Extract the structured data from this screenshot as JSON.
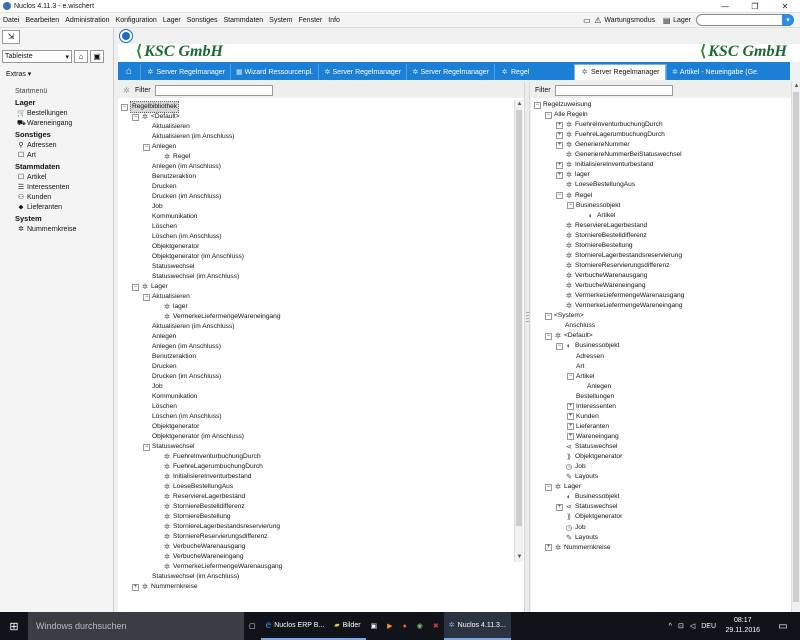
{
  "window": {
    "title": "Nuclos 4.11.3 - e.wischert",
    "controls": [
      "—",
      "❐",
      "✕"
    ]
  },
  "menu": {
    "items": [
      "Datei",
      "Bearbeiten",
      "Administration",
      "Konfiguration",
      "Lager",
      "Sonstiges",
      "Stammdaten",
      "System",
      "Fenster",
      "Info"
    ],
    "maintenance": "Wartungsmodus",
    "warehouse": "Lager"
  },
  "sidebar": {
    "toolbar_select": "Tableiste",
    "extras": "Extras",
    "start_menu_title": "Startmenü",
    "groups": [
      {
        "title": "Lager",
        "items": [
          {
            "icon": "cart-icon",
            "label": "Bestellungen"
          },
          {
            "icon": "truck-icon",
            "label": "Wareneingang"
          }
        ]
      },
      {
        "title": "Sonstiges",
        "items": [
          {
            "icon": "location-icon",
            "label": "Adressen"
          },
          {
            "icon": "box-icon",
            "label": "Art"
          }
        ]
      },
      {
        "title": "Stammdaten",
        "items": [
          {
            "icon": "box-icon",
            "label": "Artikel"
          },
          {
            "icon": "list-icon",
            "label": "Interessenten"
          },
          {
            "icon": "people-icon",
            "label": "Kunden"
          },
          {
            "icon": "tag-icon",
            "label": "Lieferanten"
          }
        ]
      },
      {
        "title": "System",
        "items": [
          {
            "icon": "gear-icon",
            "label": "Nummernkreise"
          }
        ]
      }
    ]
  },
  "brand": {
    "name": "KSC GmbH"
  },
  "tabs": [
    {
      "label": "Server Regelmanager",
      "active": false
    },
    {
      "label": "Wizard Ressourcenpl.",
      "active": false
    },
    {
      "label": "Server Regelmanager",
      "active": false
    },
    {
      "label": "Server Regelmanager",
      "active": false
    },
    {
      "label": "Regel",
      "active": false
    },
    {
      "label": "Server Regelmanager",
      "active": true
    },
    {
      "label": "Artikel - Neueingabe (Ge...",
      "active": false
    }
  ],
  "left_panel": {
    "filter_label": "Filter",
    "tree": [
      {
        "d": 0,
        "t": "-",
        "i": "",
        "label": "Regelbibliothek",
        "sel": true
      },
      {
        "d": 1,
        "t": "-",
        "i": "gear",
        "label": "<Default>"
      },
      {
        "d": 2,
        "t": "",
        "i": "",
        "label": "Aktualisieren"
      },
      {
        "d": 2,
        "t": "",
        "i": "",
        "label": "Aktualisieren (im Anschluss)"
      },
      {
        "d": 2,
        "t": "-",
        "i": "",
        "label": "Anlegen"
      },
      {
        "d": 3,
        "t": "",
        "i": "gear",
        "label": "Regel"
      },
      {
        "d": 2,
        "t": "",
        "i": "",
        "label": "Anlegen (im Anschluss)"
      },
      {
        "d": 2,
        "t": "",
        "i": "",
        "label": "Benutzeraktion"
      },
      {
        "d": 2,
        "t": "",
        "i": "",
        "label": "Drucken"
      },
      {
        "d": 2,
        "t": "",
        "i": "",
        "label": "Drucken (im Anschluss)"
      },
      {
        "d": 2,
        "t": "",
        "i": "",
        "label": "Job"
      },
      {
        "d": 2,
        "t": "",
        "i": "",
        "label": "Kommunikation"
      },
      {
        "d": 2,
        "t": "",
        "i": "",
        "label": "Löschen"
      },
      {
        "d": 2,
        "t": "",
        "i": "",
        "label": "Löschen (im Anschluss)"
      },
      {
        "d": 2,
        "t": "",
        "i": "",
        "label": "Objektgenerator"
      },
      {
        "d": 2,
        "t": "",
        "i": "",
        "label": "Objektgenerator (im Anschluss)"
      },
      {
        "d": 2,
        "t": "",
        "i": "",
        "label": "Statuswechsel"
      },
      {
        "d": 2,
        "t": "",
        "i": "",
        "label": "Statuswechsel (im Anschluss)"
      },
      {
        "d": 1,
        "t": "-",
        "i": "gear",
        "label": "Lager"
      },
      {
        "d": 2,
        "t": "-",
        "i": "",
        "label": "Aktualisieren"
      },
      {
        "d": 3,
        "t": "",
        "i": "gear",
        "label": "lager"
      },
      {
        "d": 3,
        "t": "",
        "i": "gear",
        "label": "VermerkeLiefermengeWareneingang"
      },
      {
        "d": 2,
        "t": "",
        "i": "",
        "label": "Aktualisieren (im Anschluss)"
      },
      {
        "d": 2,
        "t": "",
        "i": "",
        "label": "Anlegen"
      },
      {
        "d": 2,
        "t": "",
        "i": "",
        "label": "Anlegen (im Anschluss)"
      },
      {
        "d": 2,
        "t": "",
        "i": "",
        "label": "Benutzeraktion"
      },
      {
        "d": 2,
        "t": "",
        "i": "",
        "label": "Drucken"
      },
      {
        "d": 2,
        "t": "",
        "i": "",
        "label": "Drucken (im Anschluss)"
      },
      {
        "d": 2,
        "t": "",
        "i": "",
        "label": "Job"
      },
      {
        "d": 2,
        "t": "",
        "i": "",
        "label": "Kommunikation"
      },
      {
        "d": 2,
        "t": "",
        "i": "",
        "label": "Löschen"
      },
      {
        "d": 2,
        "t": "",
        "i": "",
        "label": "Löschen (im Anschluss)"
      },
      {
        "d": 2,
        "t": "",
        "i": "",
        "label": "Objektgenerator"
      },
      {
        "d": 2,
        "t": "",
        "i": "",
        "label": "Objektgenerator (im Anschluss)"
      },
      {
        "d": 2,
        "t": "-",
        "i": "",
        "label": "Statuswechsel"
      },
      {
        "d": 3,
        "t": "",
        "i": "gear",
        "label": "FuehreInventurbuchungDurch"
      },
      {
        "d": 3,
        "t": "",
        "i": "gear",
        "label": "FuehreLagerumbuchungDurch"
      },
      {
        "d": 3,
        "t": "",
        "i": "gear",
        "label": "InitialisiereInventurbestand"
      },
      {
        "d": 3,
        "t": "",
        "i": "gear",
        "label": "LoeseBestellungAus"
      },
      {
        "d": 3,
        "t": "",
        "i": "gear",
        "label": "ReserviereLagerbestand"
      },
      {
        "d": 3,
        "t": "",
        "i": "gear",
        "label": "StorniereBestelldifferenz"
      },
      {
        "d": 3,
        "t": "",
        "i": "gear",
        "label": "StorniereBestellung"
      },
      {
        "d": 3,
        "t": "",
        "i": "gear",
        "label": "StorniereLagerbestandsreservierung"
      },
      {
        "d": 3,
        "t": "",
        "i": "gear",
        "label": "StorniereReservierungsdifferenz"
      },
      {
        "d": 3,
        "t": "",
        "i": "gear",
        "label": "VerbucheWarenausgang"
      },
      {
        "d": 3,
        "t": "",
        "i": "gear",
        "label": "VerbucheWareneingang"
      },
      {
        "d": 3,
        "t": "",
        "i": "gear",
        "label": "VermerkeLiefermengeWarenausgang"
      },
      {
        "d": 2,
        "t": "",
        "i": "",
        "label": "Statuswechsel (im Anschluss)"
      },
      {
        "d": 1,
        "t": "+",
        "i": "gear",
        "label": "Nummernkreise"
      }
    ]
  },
  "right_panel": {
    "filter_label": "Filter",
    "tree": [
      {
        "d": 0,
        "t": "-",
        "i": "",
        "label": "Regelzuweisung"
      },
      {
        "d": 1,
        "t": "-",
        "i": "",
        "label": "Alle Regeln"
      },
      {
        "d": 2,
        "t": "+",
        "i": "gear",
        "label": "FuehreInventurbuchungDurch"
      },
      {
        "d": 2,
        "t": "+",
        "i": "gear",
        "label": "FuehreLagerumbuchungDurch"
      },
      {
        "d": 2,
        "t": "+",
        "i": "gear",
        "label": "GeneriereNummer"
      },
      {
        "d": 2,
        "t": "",
        "i": "gear",
        "label": "GeneriereNummerBeiStatuswechsel"
      },
      {
        "d": 2,
        "t": "+",
        "i": "gear",
        "label": "InitialisiereInventurbestand"
      },
      {
        "d": 2,
        "t": "+",
        "i": "gear",
        "label": "lager"
      },
      {
        "d": 2,
        "t": "",
        "i": "gear",
        "label": "LoeseBestellungAus"
      },
      {
        "d": 2,
        "t": "-",
        "i": "gear",
        "label": "Regel"
      },
      {
        "d": 3,
        "t": "-",
        "i": "",
        "label": "Businessobjekt"
      },
      {
        "d": 4,
        "t": "",
        "i": "bo",
        "label": "Artikel"
      },
      {
        "d": 2,
        "t": "",
        "i": "gear",
        "label": "ReserviereLagerbestand"
      },
      {
        "d": 2,
        "t": "",
        "i": "gear",
        "label": "StorniereBestelldifferenz"
      },
      {
        "d": 2,
        "t": "",
        "i": "gear",
        "label": "StorniereBestellung"
      },
      {
        "d": 2,
        "t": "",
        "i": "gear",
        "label": "StorniereLagerbestandsreservierung"
      },
      {
        "d": 2,
        "t": "",
        "i": "gear",
        "label": "StorniereReservierungsdifferenz"
      },
      {
        "d": 2,
        "t": "",
        "i": "gear",
        "label": "VerbucheWarenausgang"
      },
      {
        "d": 2,
        "t": "",
        "i": "gear",
        "label": "VerbucheWareneingang"
      },
      {
        "d": 2,
        "t": "",
        "i": "gear",
        "label": "VermerkeLiefermengeWarenausgang"
      },
      {
        "d": 2,
        "t": "",
        "i": "gear",
        "label": "VermerkeLiefermengeWareneingang"
      },
      {
        "d": 1,
        "t": "-",
        "i": "",
        "label": "<System>"
      },
      {
        "d": 2,
        "t": "",
        "i": "",
        "label": "Anschluss"
      },
      {
        "d": 1,
        "t": "-",
        "i": "gear",
        "label": "<Default>"
      },
      {
        "d": 2,
        "t": "-",
        "i": "bo",
        "label": "Businessobjekt"
      },
      {
        "d": 3,
        "t": "",
        "i": "",
        "label": "Adressen"
      },
      {
        "d": 3,
        "t": "",
        "i": "",
        "label": "Art"
      },
      {
        "d": 3,
        "t": "-",
        "i": "",
        "label": "Artikel"
      },
      {
        "d": 4,
        "t": "",
        "i": "",
        "label": "Anlegen"
      },
      {
        "d": 3,
        "t": "",
        "i": "",
        "label": "Bestellungen"
      },
      {
        "d": 3,
        "t": "+",
        "i": "",
        "label": "Interessenten"
      },
      {
        "d": 3,
        "t": "+",
        "i": "",
        "label": "Kunden"
      },
      {
        "d": 3,
        "t": "+",
        "i": "",
        "label": "Lieferanten"
      },
      {
        "d": 3,
        "t": "+",
        "i": "",
        "label": "Wareneingang"
      },
      {
        "d": 2,
        "t": "",
        "i": "status",
        "label": "Statuswechsel"
      },
      {
        "d": 2,
        "t": "",
        "i": "gen",
        "label": "Objektgenerator"
      },
      {
        "d": 2,
        "t": "",
        "i": "job",
        "label": "Job"
      },
      {
        "d": 2,
        "t": "",
        "i": "layout",
        "label": "Layouts"
      },
      {
        "d": 1,
        "t": "-",
        "i": "gear",
        "label": "Lager"
      },
      {
        "d": 2,
        "t": "",
        "i": "bo",
        "label": "Businessobjekt"
      },
      {
        "d": 2,
        "t": "+",
        "i": "status",
        "label": "Statuswechsel"
      },
      {
        "d": 2,
        "t": "",
        "i": "gen",
        "label": "Objektgenerator"
      },
      {
        "d": 2,
        "t": "",
        "i": "job",
        "label": "Job"
      },
      {
        "d": 2,
        "t": "",
        "i": "layout",
        "label": "Layouts"
      },
      {
        "d": 1,
        "t": "+",
        "i": "gear",
        "label": "Nummernkreise"
      }
    ]
  },
  "taskbar": {
    "search_placeholder": "Windows durchsuchen",
    "apps": [
      {
        "icon": "nuclos-icon",
        "label": "Nuclos ERP B..."
      },
      {
        "icon": "folder-icon",
        "label": "Bilder"
      },
      {
        "icon": "nuclos-icon",
        "label": "Nuclos 4.11.3..."
      }
    ],
    "language": "DEU",
    "time": "08:17",
    "date": "29.11.2016"
  }
}
